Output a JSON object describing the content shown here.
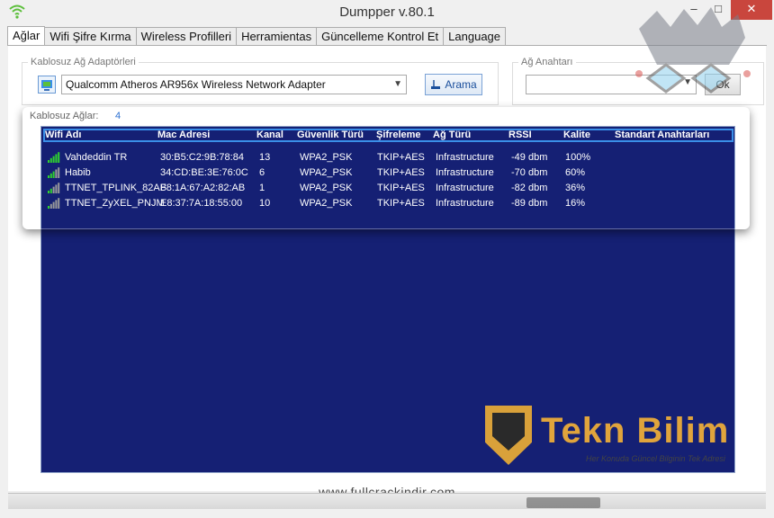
{
  "window": {
    "title": "Dumpper v.80.1",
    "minimize_glyph": "–",
    "maximize_glyph": "□",
    "close_glyph": "✕"
  },
  "tabs": [
    {
      "label": "Ağlar",
      "active": true
    },
    {
      "label": "Wifi Şifre Kırma",
      "active": false
    },
    {
      "label": "Wireless Profilleri",
      "active": false
    },
    {
      "label": "Herramientas",
      "active": false
    },
    {
      "label": "Güncelleme Kontrol Et",
      "active": false
    },
    {
      "label": "Language",
      "active": false
    }
  ],
  "adapters": {
    "group_title": "Kablosuz Ağ Adaptörleri",
    "selected": "Qualcomm Atheros AR956x Wireless Network Adapter",
    "search_label": "Arama"
  },
  "network_key": {
    "group_title": "Ağ Anahtarı",
    "value": "",
    "ok_label": "Ok"
  },
  "networks": {
    "label": "Kablosuz Ağlar:",
    "count": "4",
    "columns": [
      "Wifi Adı",
      "Mac Adresi",
      "Kanal",
      "Güvenlik Türü",
      "Şifreleme",
      "Ağ Türü",
      "RSSI",
      "Kalite",
      "Standart Anahtarları"
    ],
    "rows": [
      {
        "name": "Vahdeddin TR",
        "mac": "30:B5:C2:9B:78:84",
        "channel": "13",
        "security": "WPA2_PSK",
        "encryption": "TKIP+AES",
        "type": "Infrastructure",
        "rssi": "-49 dbm",
        "quality": "100%",
        "bars": 5
      },
      {
        "name": "Habib",
        "mac": "34:CD:BE:3E:76:0C",
        "channel": "6",
        "security": "WPA2_PSK",
        "encryption": "TKIP+AES",
        "type": "Infrastructure",
        "rssi": "-70 dbm",
        "quality": "60%",
        "bars": 3
      },
      {
        "name": "TTNET_TPLINK_82AB",
        "mac": "F8:1A:67:A2:82:AB",
        "channel": "1",
        "security": "WPA2_PSK",
        "encryption": "TKIP+AES",
        "type": "Infrastructure",
        "rssi": "-82 dbm",
        "quality": "36%",
        "bars": 2
      },
      {
        "name": "TTNET_ZyXEL_PNJM",
        "mac": "E8:37:7A:18:55:00",
        "channel": "10",
        "security": "WPA2_PSK",
        "encryption": "TKIP+AES",
        "type": "Infrastructure",
        "rssi": "-89 dbm",
        "quality": "16%",
        "bars": 1
      }
    ]
  },
  "logo": {
    "brand": "Tekn Bilim",
    "tagline": "Her Konuda Güncel Bilginin Tek Adresi"
  },
  "watermark": "www.fullcrackindir.com",
  "colors": {
    "list_bg": "#152074",
    "header_border": "#3a8fe8",
    "signal_on": "#2fd12f",
    "signal_off": "#9a9a9a",
    "close_bg": "#c9463d",
    "logo_gold": "#e0a43c",
    "count_blue": "#2b6fd1"
  }
}
